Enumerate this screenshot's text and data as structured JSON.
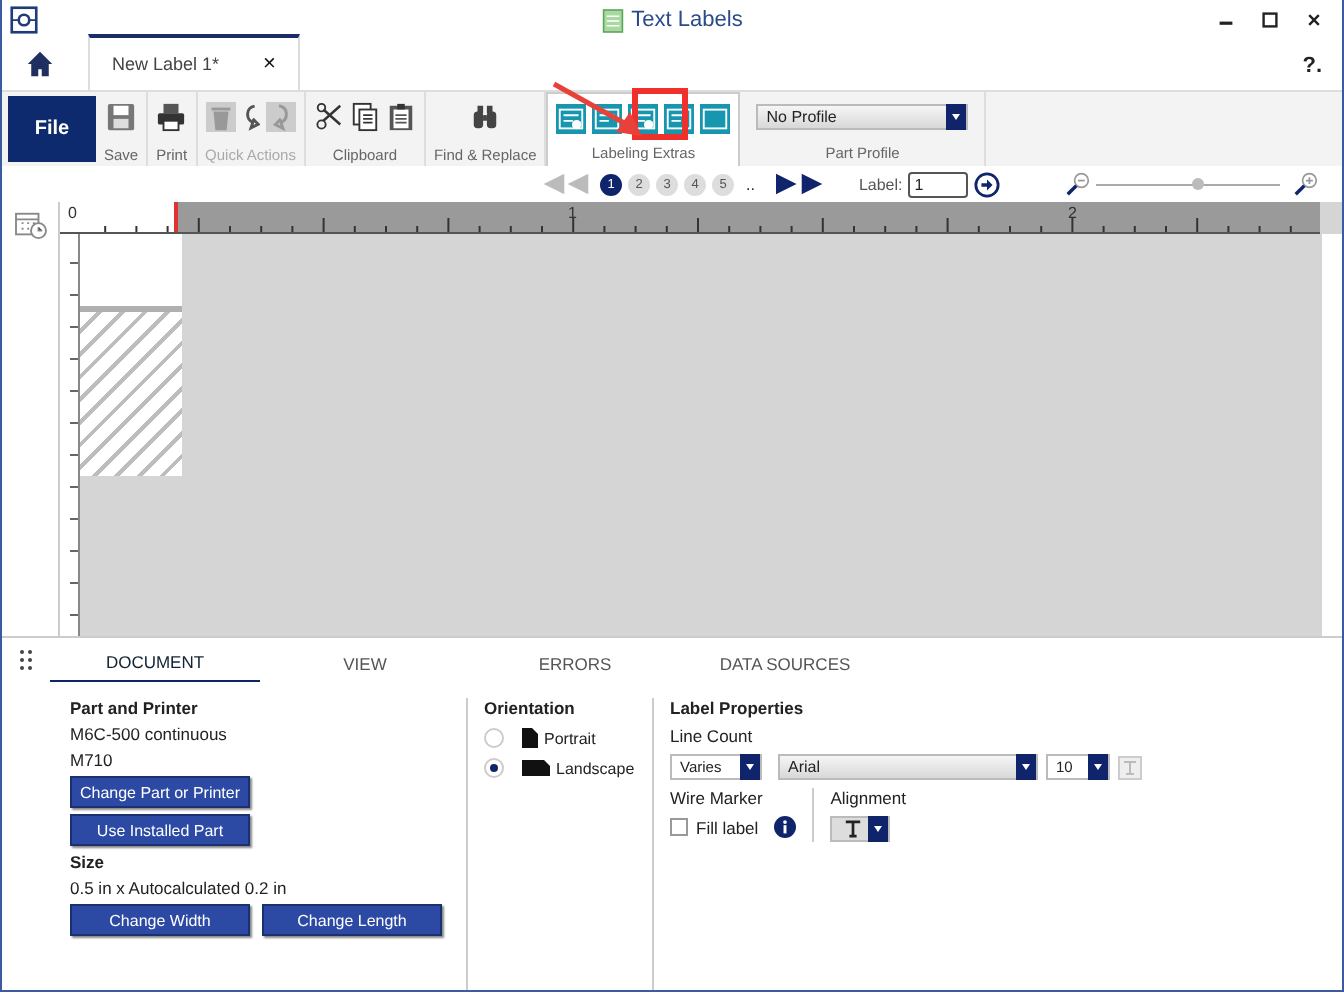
{
  "window": {
    "title": "Text Labels"
  },
  "doc_tabs": [
    {
      "label": "New Label 1*",
      "close": "×",
      "selected": true
    }
  ],
  "help": "?.",
  "ribbon": {
    "file": "File",
    "groups": [
      {
        "label": "Save",
        "disabled": false
      },
      {
        "label": "Print",
        "disabled": false
      },
      {
        "label": "Quick Actions",
        "disabled": true
      },
      {
        "label": "Clipboard",
        "disabled": false
      },
      {
        "label": "Find & Replace",
        "disabled": false
      },
      {
        "label": "Labeling Extras",
        "disabled": false
      },
      {
        "label": "Part Profile",
        "disabled": false
      }
    ],
    "profile": "No Profile"
  },
  "navigator": {
    "pages": [
      {
        "label": "1",
        "selected": true
      },
      {
        "label": "2",
        "selected": false
      },
      {
        "label": "3",
        "selected": false
      },
      {
        "label": "4",
        "selected": false
      },
      {
        "label": "5",
        "selected": false
      }
    ],
    "more": "..",
    "label_caption": "Label:",
    "label_value": "1",
    "zoom": {
      "level": 0.55
    }
  },
  "ruler": [
    "0",
    "1",
    "2"
  ],
  "panel_tabs": [
    {
      "label": "DOCUMENT",
      "selected": true
    },
    {
      "label": "VIEW",
      "selected": false
    },
    {
      "label": "ERRORS",
      "selected": false
    },
    {
      "label": "DATA SOURCES",
      "selected": false
    }
  ],
  "document": {
    "part_heading": "Part and Printer",
    "part": "M6C-500 continuous",
    "printer": "M710",
    "part_buttons": [
      "Change Part or Printer",
      "Use Installed Part"
    ],
    "size_heading": "Size",
    "size": "0.5 in x Autocalculated 0.2 in",
    "size_buttons": [
      "Change Width",
      "Change Length"
    ]
  },
  "orientation": {
    "heading": "Orientation",
    "options": [
      {
        "label": "Portrait",
        "selected": false
      },
      {
        "label": "Landscape",
        "selected": true
      }
    ]
  },
  "label_properties": {
    "heading": "Label Properties",
    "line_count_caption": "Line Count",
    "line_count": "Varies",
    "font": "Arial",
    "font_size": "10",
    "wire_marker_caption": "Wire Marker",
    "fill_label": {
      "label": "Fill label",
      "checked": false
    },
    "alignment_caption": "Alignment"
  }
}
